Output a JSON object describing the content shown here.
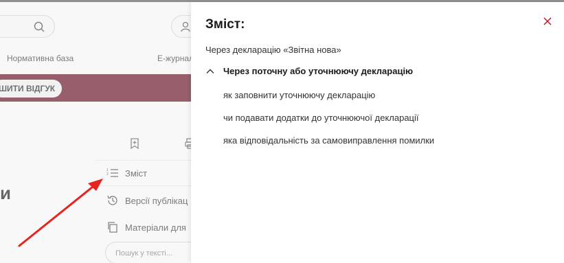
{
  "background": {
    "nav": {
      "item1": "Нормативна база",
      "item2": "Е-журнал"
    },
    "banner": {
      "feedback_label": "ШИТИ ВІДГУК",
      "color": "#5e0a1c"
    },
    "sidebar": {
      "items": [
        {
          "label": "Зміст",
          "icon": "list-numbered-icon"
        },
        {
          "label": "Версії публікац",
          "icon": "history-icon"
        },
        {
          "label": "Матеріали для",
          "icon": "copy-icon"
        }
      ],
      "search_placeholder": "Пошук у тексті..."
    },
    "heading_fragment": "и"
  },
  "toc_panel": {
    "title": "Зміст:",
    "close_icon": "close-icon",
    "accent": "#c8102e",
    "items": [
      {
        "label": "Через декларацію «Звітна нова»"
      },
      {
        "label": "Через поточну або уточнюючу декларацію",
        "expanded": true
      }
    ],
    "subitems": [
      {
        "label": "як заповнити уточнюючу декларацію"
      },
      {
        "label": "чи подавати додатки до уточнюючої декларації"
      },
      {
        "label": "яка відповідальність за самовиправлення помилки"
      }
    ]
  }
}
